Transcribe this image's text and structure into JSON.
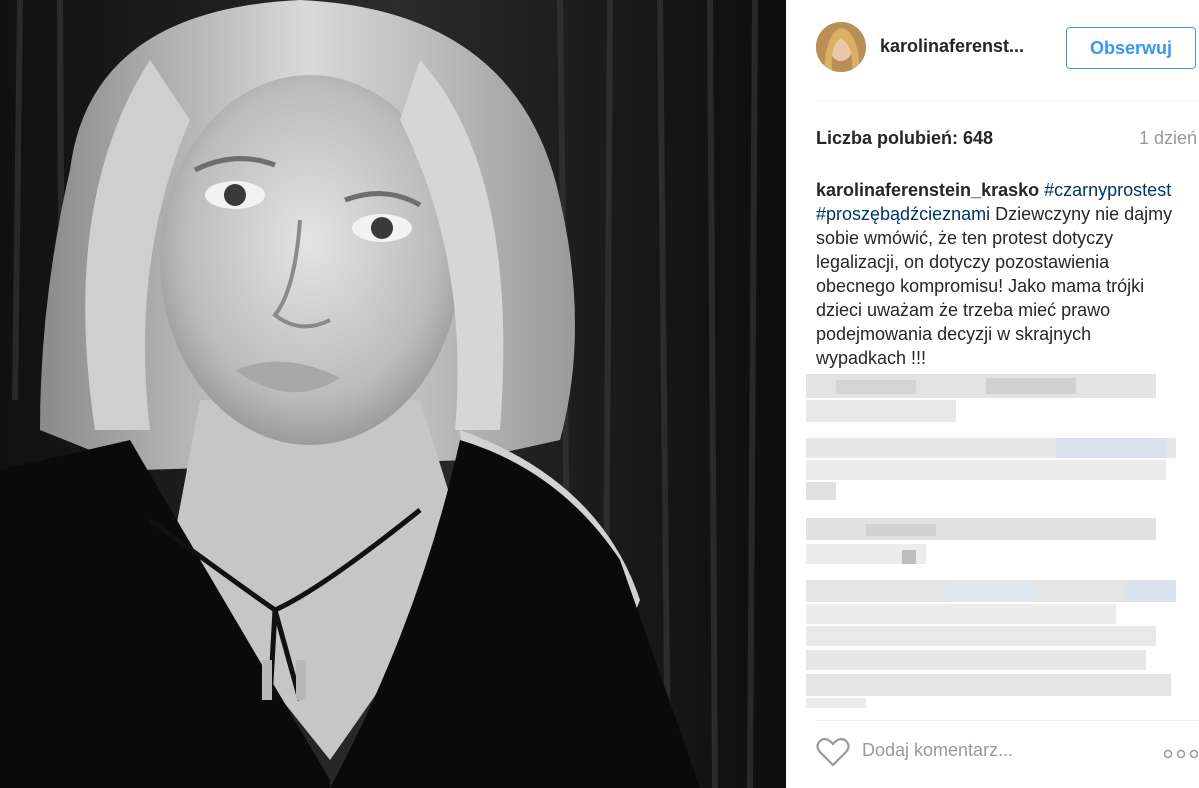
{
  "post": {
    "photo_alt": "",
    "colors": {
      "accent": "#3897f0",
      "hashtag": "#003569",
      "muted": "#999999",
      "text": "#262626"
    }
  },
  "header": {
    "username": "karolinaferenst...",
    "follow_label": "Obserwuj",
    "avatar_icon": "user-avatar"
  },
  "meta": {
    "likes": "Liczba polubień: 648",
    "time": "1 dzień"
  },
  "caption": {
    "author": "karolinaferenstein_krasko",
    "tags_line": "#czarnyprostest #proszębądźcieznami",
    "text": "Dziewczyny nie dajmy sobie wmówić, że ten protest dotyczy legalizacji, on dotyczy pozostawienia obecnego kompromisu! Jako mama trójki dzieci uważam że trzeba mieć prawo podejmowania decyzji w skrajnych wypadkach !!!",
    "tag1": "#czarnyprostest",
    "tag2": "#proszębądźcieznami"
  },
  "comment_box": {
    "placeholder": "Dodaj komentarz...",
    "like_icon": "heart-icon",
    "more_icon": "more-options-icon"
  }
}
